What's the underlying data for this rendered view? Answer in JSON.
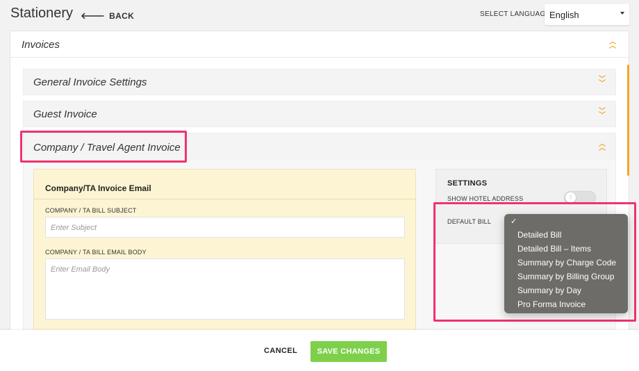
{
  "header": {
    "title": "Stationery",
    "back_label": "BACK",
    "language_label": "SELECT LANGUAGE",
    "language_value": "English"
  },
  "invoices": {
    "title": "Invoices",
    "sections": [
      {
        "label": "General Invoice Settings",
        "state": "collapsed"
      },
      {
        "label": "Guest Invoice",
        "state": "collapsed"
      },
      {
        "label": "Company / Travel Agent Invoice",
        "state": "expanded"
      }
    ]
  },
  "email_card": {
    "heading": "Company/TA Invoice Email",
    "subject_label": "COMPANY / TA BILL SUBJECT",
    "subject_placeholder": "Enter Subject",
    "body_label": "COMPANY / TA BILL EMAIL BODY",
    "body_placeholder": "Enter Email Body"
  },
  "settings": {
    "heading": "SETTINGS",
    "show_hotel_address_label": "SHOW HOTEL ADDRESS",
    "show_hotel_address_on": false,
    "default_bill_label": "DEFAULT BILL"
  },
  "default_bill_dropdown": {
    "check": "✓",
    "options": [
      "Detailed Bill",
      "Detailed Bill – Items",
      "Summary by Charge Code",
      "Summary by Billing Group",
      "Summary by Day",
      "Pro Forma Invoice"
    ]
  },
  "footer": {
    "cancel_label": "CANCEL",
    "save_label": "SAVE CHANGES"
  },
  "colors": {
    "accent": "#f5a623",
    "highlight": "#f0326e",
    "save_button": "#7ed04b",
    "email_card_bg": "#fdf4d3",
    "dropdown_bg": "#6e6c69"
  }
}
